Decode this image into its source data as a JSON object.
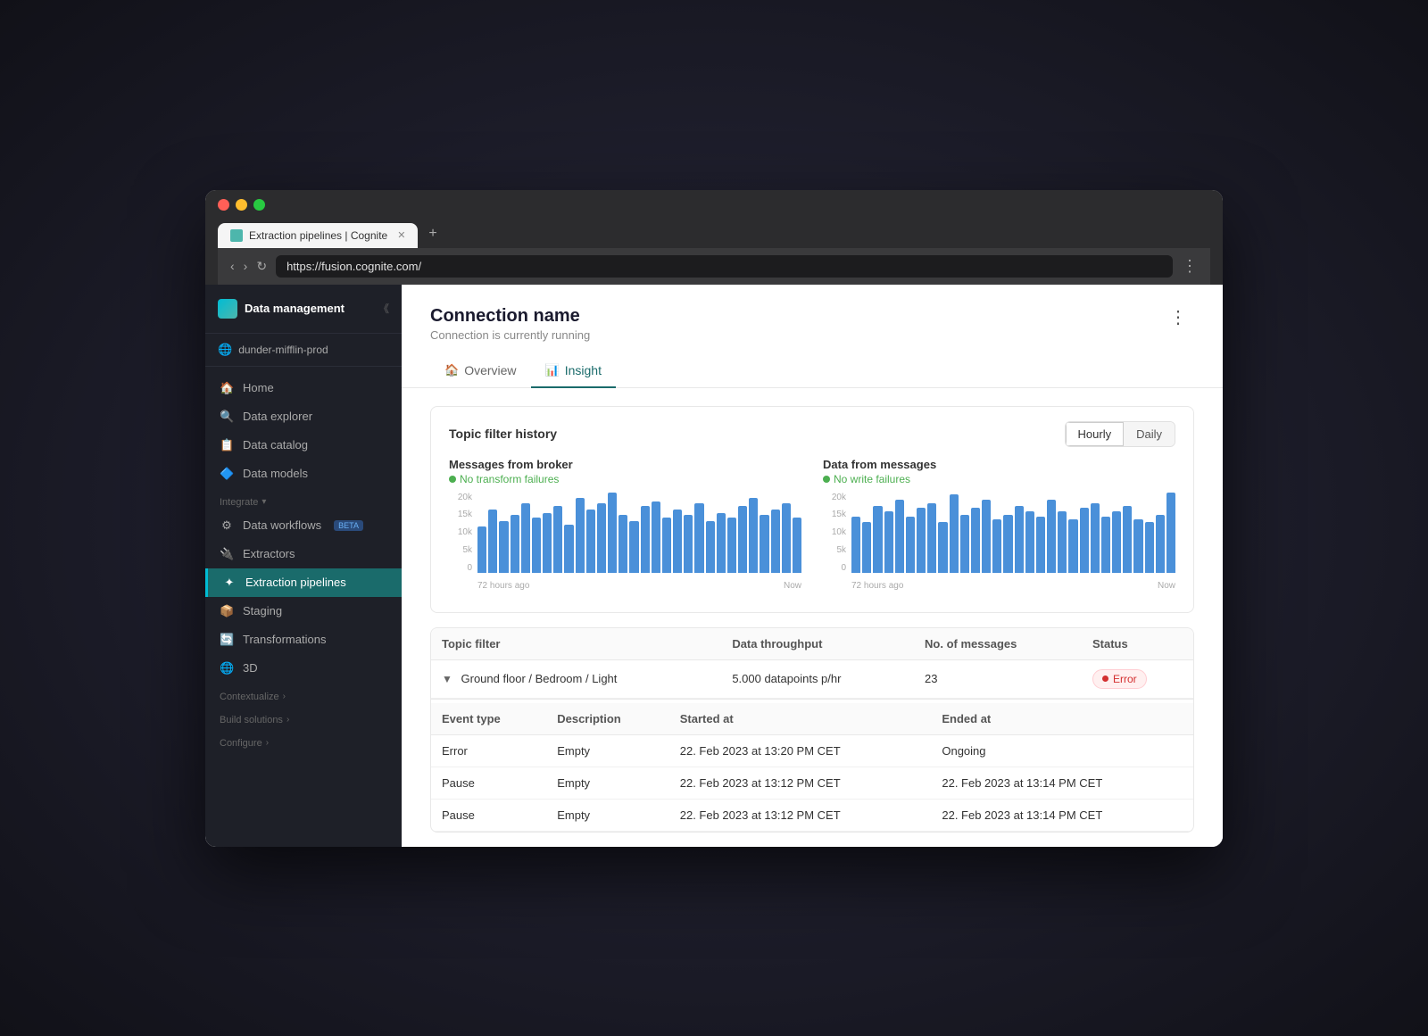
{
  "browser": {
    "url": "https://fusion.cognite.com/",
    "tab_title": "Extraction pipelines | Cognite",
    "tab_icon": "🔷"
  },
  "sidebar": {
    "title": "Data management",
    "workspace": "dunder-mifflin-prod",
    "nav_items": [
      {
        "id": "home",
        "label": "Home",
        "icon": "🏠",
        "active": false
      },
      {
        "id": "data-explorer",
        "label": "Data explorer",
        "icon": "🔍",
        "active": false
      },
      {
        "id": "data-catalog",
        "label": "Data catalog",
        "icon": "📋",
        "active": false
      },
      {
        "id": "data-models",
        "label": "Data models",
        "icon": "🔷",
        "active": false
      }
    ],
    "integrate_label": "Integrate",
    "integrate_items": [
      {
        "id": "data-workflows",
        "label": "Data workflows",
        "icon": "⚙",
        "badge": "BETA",
        "active": false
      },
      {
        "id": "extractors",
        "label": "Extractors",
        "icon": "🔌",
        "active": false
      },
      {
        "id": "extraction-pipelines",
        "label": "Extraction pipelines",
        "icon": "✦",
        "active": true
      },
      {
        "id": "staging",
        "label": "Staging",
        "icon": "📦",
        "active": false
      },
      {
        "id": "transformations",
        "label": "Transformations",
        "icon": "🔄",
        "active": false
      },
      {
        "id": "3d",
        "label": "3D",
        "icon": "🌐",
        "active": false
      }
    ],
    "contextualize_label": "Contextualize",
    "build_solutions_label": "Build solutions",
    "configure_label": "Configure"
  },
  "page": {
    "title": "Connection name",
    "subtitle": "Connection is currently running",
    "tabs": [
      {
        "id": "overview",
        "label": "Overview",
        "icon": "🏠"
      },
      {
        "id": "insight",
        "label": "Insight",
        "icon": "📊"
      }
    ],
    "active_tab": "insight"
  },
  "insight": {
    "section_title": "Topic filter history",
    "toggle": {
      "hourly": "Hourly",
      "daily": "Daily",
      "active": "Hourly"
    },
    "messages_chart": {
      "title": "Messages from broker",
      "status": "No transform failures",
      "y_labels": [
        "20k",
        "15k",
        "10k",
        "5k",
        "0"
      ],
      "x_labels": [
        "72 hours ago",
        "Now"
      ],
      "bars": [
        40,
        55,
        45,
        50,
        60,
        48,
        52,
        58,
        42,
        65,
        55,
        60,
        70,
        50,
        45,
        58,
        62,
        48,
        55,
        50,
        60,
        45,
        52,
        48,
        58,
        65,
        50,
        55,
        60,
        48
      ]
    },
    "data_chart": {
      "title": "Data from messages",
      "status": "No write failures",
      "y_labels": [
        "20k",
        "15k",
        "10k",
        "5k",
        "0"
      ],
      "x_labels": [
        "72 hours ago",
        "Now"
      ],
      "bars": [
        50,
        45,
        60,
        55,
        65,
        50,
        58,
        62,
        45,
        70,
        52,
        58,
        65,
        48,
        52,
        60,
        55,
        50,
        65,
        55,
        48,
        58,
        62,
        50,
        55,
        60,
        48,
        45,
        52,
        72
      ]
    },
    "table": {
      "headers": [
        "Topic filter",
        "Data throughput",
        "No. of messages",
        "Status"
      ],
      "rows": [
        {
          "filter": "Ground floor / Bedroom / Light",
          "throughput": "5.000 datapoints p/hr",
          "messages": "23",
          "status": "Error"
        }
      ]
    },
    "events_table": {
      "headers": [
        "Event type",
        "Description",
        "Started at",
        "Ended at"
      ],
      "rows": [
        {
          "type": "Error",
          "description": "Empty",
          "started": "22. Feb 2023 at 13:20 PM CET",
          "ended": "Ongoing"
        },
        {
          "type": "Pause",
          "description": "Empty",
          "started": "22. Feb 2023 at 13:12 PM CET",
          "ended": "22. Feb 2023 at 13:14 PM CET"
        },
        {
          "type": "Pause",
          "description": "Empty",
          "started": "22. Feb 2023 at 13:12 PM CET",
          "ended": "22. Feb 2023 at 13:14 PM CET"
        }
      ]
    }
  }
}
